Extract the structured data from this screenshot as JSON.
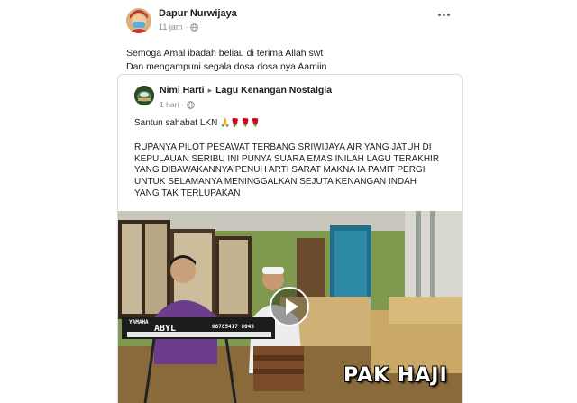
{
  "post": {
    "author": "Dapur Nurwijaya",
    "time": "11 jam",
    "privacy_icon": "globe-icon",
    "more_icon": "more-options-icon",
    "caption_lines": [
      "Semoga Amal ibadah beliau di terima Allah swt",
      "Dan mengampuni segala dosa dosa nya Aamiin"
    ]
  },
  "shared_post": {
    "author": "Nimi Harti",
    "arrow": "▸",
    "group": "Lagu Kenangan Nostalgia",
    "time": "1 hari",
    "privacy_icon": "globe-icon",
    "greeting": "Santun sahabat LKN",
    "greeting_emojis": "🙏🌹🌹🌹",
    "body_lines": [
      "RUPANYA PILOT PESAWAT TERBANG SRIWIJAYA AIR YANG JATUH DI",
      "KEPULAUAN SERIBU INI PUNYA SUARA EMAS INILAH LAGU TERAKHIR",
      "YANG DIBAWAKANNYA PENUH ARTI SARAT MAKNA IA PAMIT PERGI",
      "UNTUK SELAMANYA MENINGGALKAN SEJUTA KENANGAN INDAH",
      "YANG TAK TERLUPAKAN"
    ]
  },
  "video": {
    "watermark": "PAK HAJI",
    "keyboard_brand": "YAMAHA",
    "keyboard_text": "ABYL",
    "keyboard_phone": "08785417 8043",
    "play_icon": "play-icon"
  }
}
